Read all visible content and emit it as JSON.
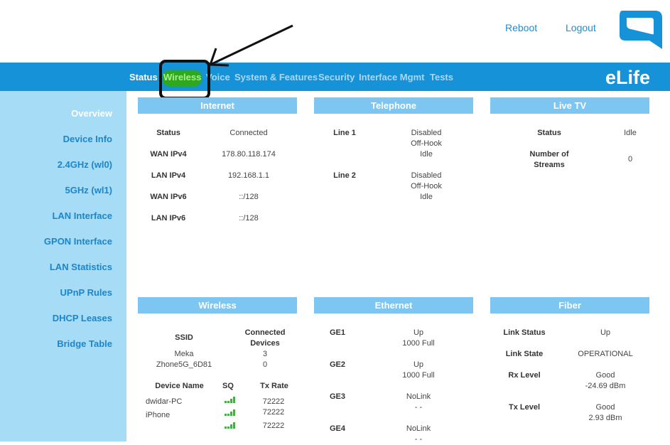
{
  "header": {
    "reboot": "Reboot",
    "logout": "Logout"
  },
  "nav": {
    "items": [
      "Status",
      "Wireless",
      "Voice",
      "System & Features",
      "Security",
      "Interface Mgmt",
      "Tests"
    ],
    "active": "Status",
    "brand": "eLife"
  },
  "sidebar": {
    "items": [
      "Overview",
      "Device Info",
      "2.4GHz (wl0)",
      "5GHz (wl1)",
      "LAN Interface",
      "GPON Interface",
      "LAN Statistics",
      "UPnP Rules",
      "DHCP Leases",
      "Bridge Table"
    ],
    "active": "Overview"
  },
  "internet": {
    "title": "Internet",
    "rows": [
      {
        "label": "Status",
        "value": "Connected"
      },
      {
        "label": "WAN IPv4",
        "value": "178.80.118.174"
      },
      {
        "label": "LAN IPv4",
        "value": "192.168.1.1"
      },
      {
        "label": "WAN IPv6",
        "value": "::/128"
      },
      {
        "label": "LAN IPv6",
        "value": "::/128"
      }
    ]
  },
  "telephone": {
    "title": "Telephone",
    "lines": [
      {
        "label": "Line 1",
        "v1": "Disabled",
        "v2": "Off-Hook",
        "v3": "Idle"
      },
      {
        "label": "Line 2",
        "v1": "Disabled",
        "v2": "Off-Hook",
        "v3": "Idle"
      }
    ]
  },
  "livetv": {
    "title": "Live TV",
    "status_label": "Status",
    "status_value": "Idle",
    "streams_label_1": "Number of",
    "streams_label_2": "Streams",
    "streams_value": "0"
  },
  "wireless": {
    "title": "Wireless",
    "ssid_header": "SSID",
    "connected_header_1": "Connected",
    "connected_header_2": "Devices",
    "networks": [
      {
        "ssid": "Meka",
        "devices": "3"
      },
      {
        "ssid": "Zhone5G_6D81",
        "devices": "0"
      }
    ],
    "device_name_header": "Device Name",
    "sq_header": "SQ",
    "tx_header": "Tx Rate",
    "devices": [
      {
        "name": "dwidar-PC",
        "tx": "72222"
      },
      {
        "name": "iPhone",
        "tx": "72222"
      },
      {
        "name": "",
        "tx": "72222"
      }
    ]
  },
  "ethernet": {
    "title": "Ethernet",
    "ports": [
      {
        "label": "GE1",
        "v1": "Up",
        "v2": "1000 Full"
      },
      {
        "label": "GE2",
        "v1": "Up",
        "v2": "1000 Full"
      },
      {
        "label": "GE3",
        "v1": "NoLink",
        "v2": "- -"
      },
      {
        "label": "GE4",
        "v1": "NoLink",
        "v2": "- -"
      }
    ]
  },
  "fiber": {
    "title": "Fiber",
    "rows": [
      {
        "label": "Link Status",
        "v1": "Up",
        "v2": ""
      },
      {
        "label": "Link State",
        "v1": "OPERATIONAL",
        "v2": ""
      },
      {
        "label": "Rx Level",
        "v1": "Good",
        "v2": "-24.69 dBm"
      },
      {
        "label": "Tx Level",
        "v1": "Good",
        "v2": "2.93 dBm"
      }
    ]
  },
  "colors": {
    "brand_blue": "#1592d8",
    "panel_header": "#7dc6f2",
    "sidebar_bg": "#a6dcf5",
    "annotation_green": "#2ea81e"
  }
}
